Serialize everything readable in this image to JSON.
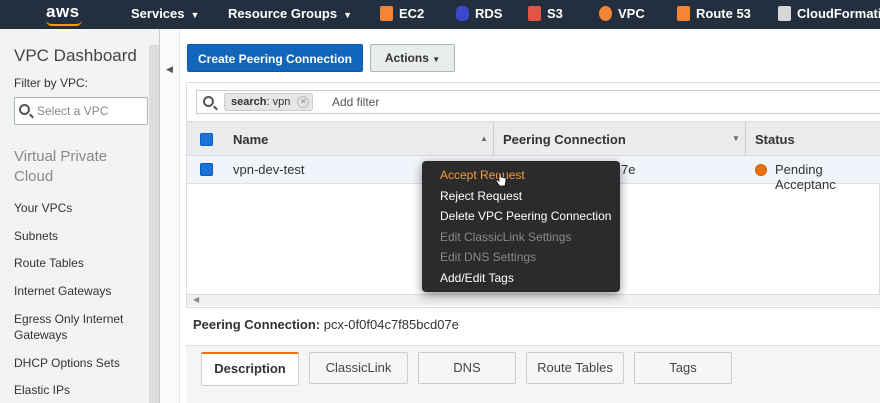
{
  "nav": {
    "logo": "aws",
    "services": "Services",
    "resource_groups": "Resource Groups",
    "shortcuts": [
      {
        "label": "EC2",
        "color": "#f58536"
      },
      {
        "label": "RDS",
        "color": "#3b48cc"
      },
      {
        "label": "S3",
        "color": "#e25444"
      },
      {
        "label": "VPC",
        "color": "#f58536"
      },
      {
        "label": "Route 53",
        "color": "#f58536"
      },
      {
        "label": "CloudFormati",
        "color": "#d6d6d6"
      }
    ]
  },
  "sidebar": {
    "title": "VPC Dashboard",
    "filter_label": "Filter by VPC:",
    "vpc_select_placeholder": "Select a VPC",
    "section": "Virtual Private Cloud",
    "items": [
      {
        "label": "Your VPCs"
      },
      {
        "label": "Subnets"
      },
      {
        "label": "Route Tables"
      },
      {
        "label": "Internet Gateways"
      },
      {
        "label": "Egress Only Internet Gateways"
      },
      {
        "label": "DHCP Options Sets"
      },
      {
        "label": "Elastic IPs"
      }
    ]
  },
  "toolbar": {
    "create_label": "Create Peering Connection",
    "actions_label": "Actions"
  },
  "search": {
    "token_key": "search",
    "token_value": ": vpn",
    "add_filter": "Add filter"
  },
  "table": {
    "columns": [
      "Name",
      "Peering Connection",
      "Status"
    ],
    "rows": [
      {
        "name": "vpn-dev-test",
        "peering_connection": "7e",
        "status": "Pending Acceptanc"
      }
    ]
  },
  "context_menu": {
    "items": [
      {
        "label": "Accept Request",
        "state": "hover"
      },
      {
        "label": "Reject Request",
        "state": "enabled"
      },
      {
        "label": "Delete VPC Peering Connection",
        "state": "enabled"
      },
      {
        "label": "Edit ClassicLink Settings",
        "state": "disabled"
      },
      {
        "label": "Edit DNS Settings",
        "state": "disabled"
      },
      {
        "label": "Add/Edit Tags",
        "state": "enabled"
      }
    ]
  },
  "details": {
    "label": "Peering Connection:",
    "value": "pcx-0f0f04c7f85bcd07e",
    "tabs": [
      "Description",
      "ClassicLink",
      "DNS",
      "Route Tables",
      "Tags"
    ],
    "active_tab": "Description"
  },
  "colors": {
    "nav_bg": "#232f3e",
    "primary": "#1166bb",
    "accent": "#ec7211"
  }
}
